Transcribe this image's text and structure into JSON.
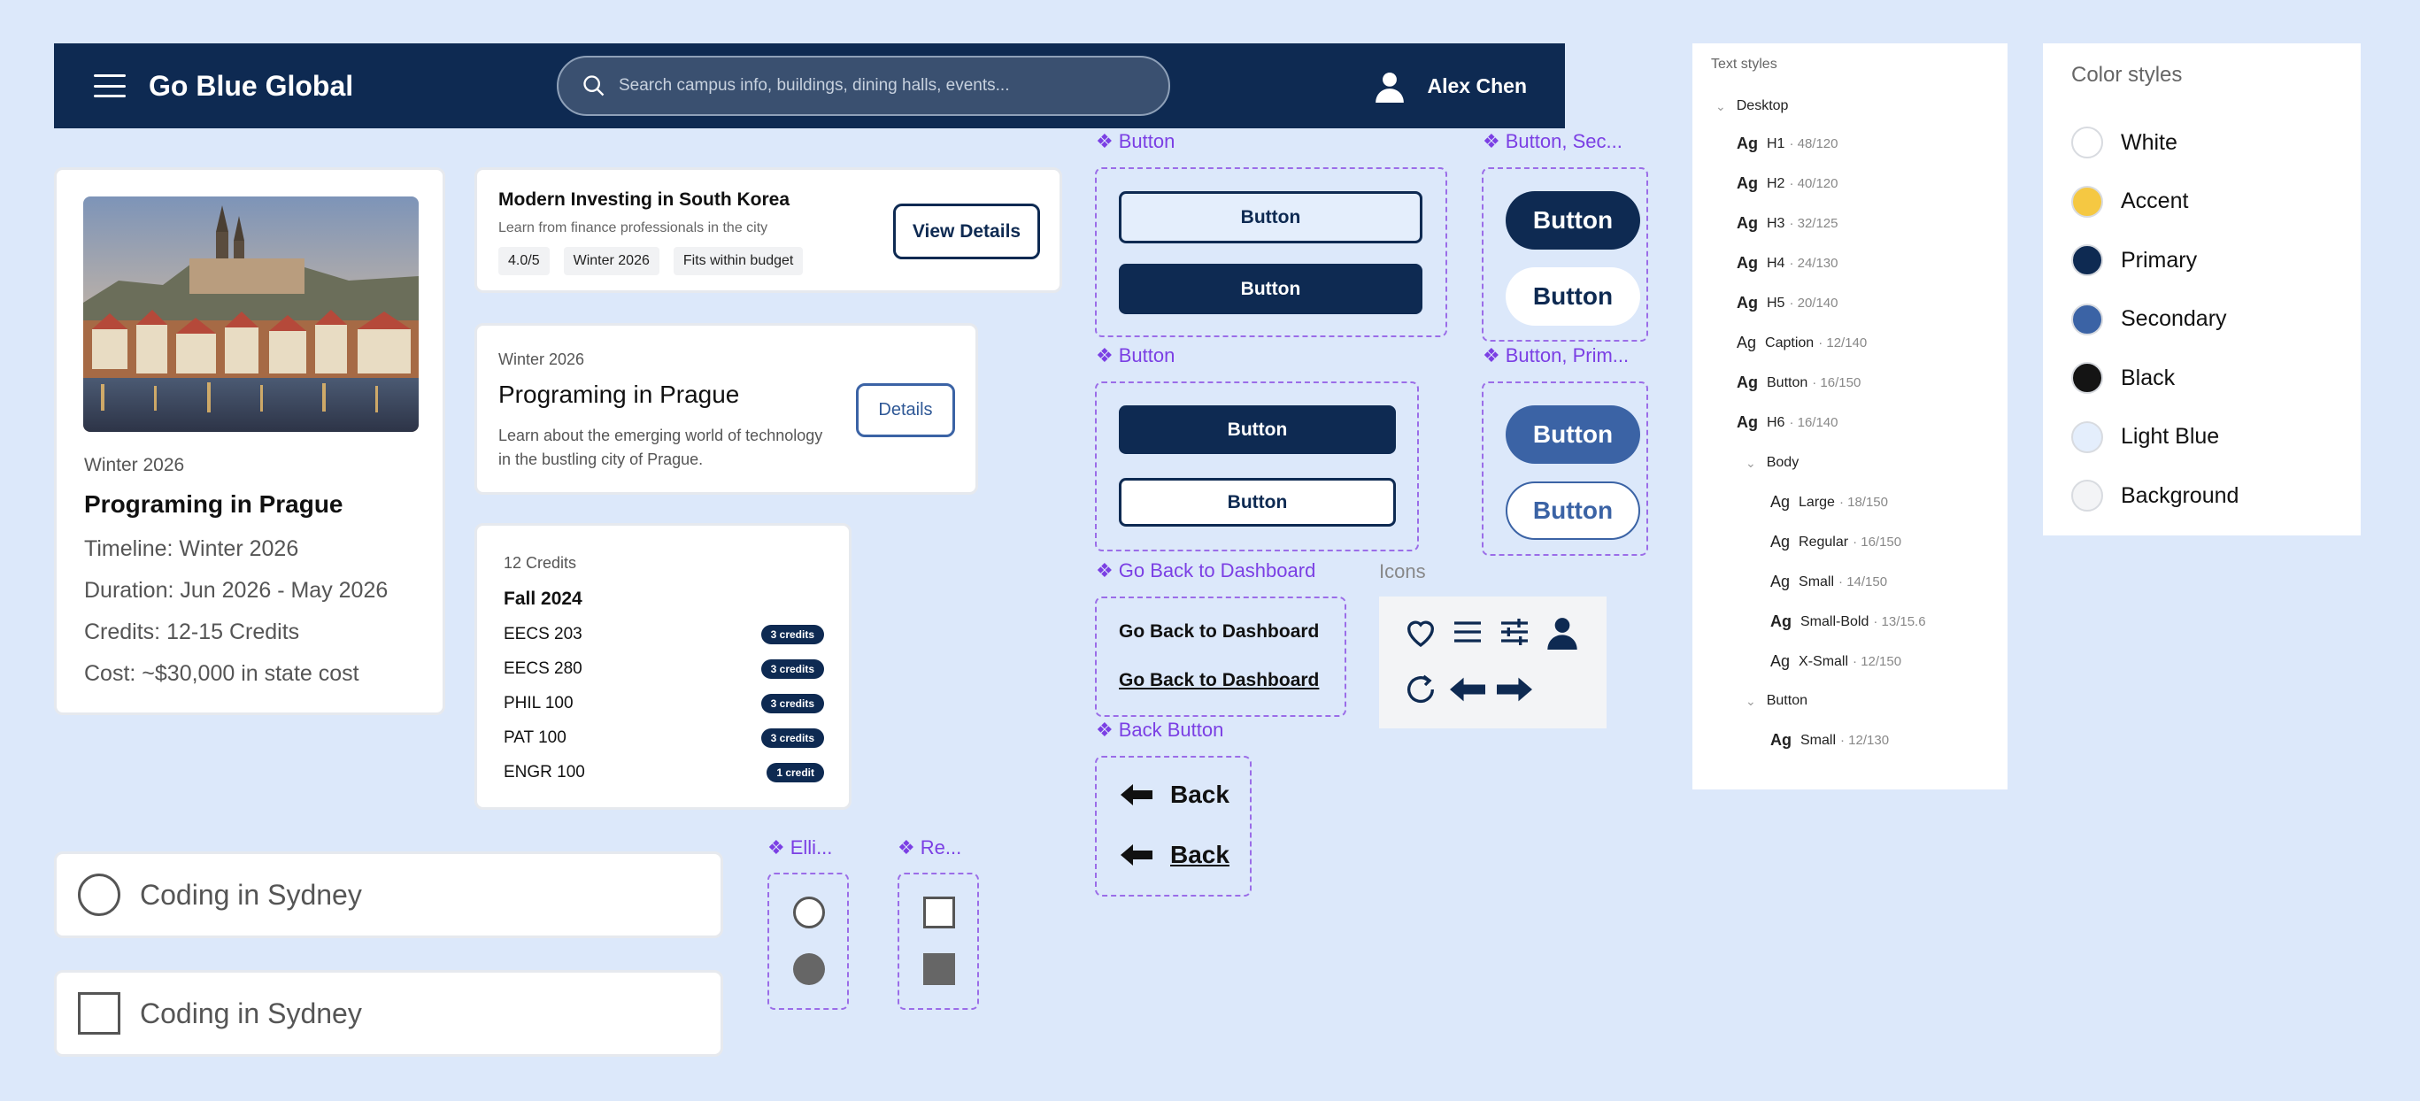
{
  "header": {
    "title": "Go Blue Global",
    "search_placeholder": "Search campus info, buildings, dining halls, events...",
    "user_name": "Alex Chen"
  },
  "main_card": {
    "term": "Winter 2026",
    "title": "Programing in Prague",
    "lines": [
      "Timeline: Winter 2026",
      "Duration: Jun 2026 - May 2026",
      "Credits: 12-15 Credits",
      "Cost: ~$30,000 in state cost"
    ]
  },
  "investing_card": {
    "title": "Modern Investing in South Korea",
    "subtitle": "Learn from finance professionals in the city",
    "tags": [
      "4.0/5",
      "Winter 2026",
      "Fits within budget"
    ],
    "button_label": "View Details"
  },
  "prague_card": {
    "term": "Winter 2026",
    "title": "Programing in Prague",
    "description": "Learn about the emerging world of technology in the bustling city of Prague.",
    "button_label": "Details"
  },
  "credits_card": {
    "credits_label": "12 Credits",
    "semester": "Fall 2024",
    "courses": [
      {
        "name": "EECS 203",
        "credits": "3 credits"
      },
      {
        "name": "EECS 280",
        "credits": "3 credits"
      },
      {
        "name": "PHIL 100",
        "credits": "3 credits"
      },
      {
        "name": "PAT 100",
        "credits": "3 credits"
      },
      {
        "name": "ENGR 100",
        "credits": "1 credit"
      }
    ]
  },
  "choices": [
    {
      "label": "Coding in Sydney",
      "kind": "radio"
    },
    {
      "label": "Coding in Sydney",
      "kind": "checkbox"
    }
  ],
  "components": {
    "ellipse_label": "Elli...",
    "rect_label": "Re...",
    "button_label": "Button",
    "button_secondary_label": "Button, Sec...",
    "button_primary_label": "Button, Prim...",
    "go_back_label": "Go Back to Dashboard",
    "back_button_label": "Back Button",
    "button_text": "Button",
    "go_back_text": "Go Back to Dashboard",
    "back_text": "Back",
    "icons_label": "Icons"
  },
  "text_styles": {
    "header": "Text styles",
    "desktop_group": "Desktop",
    "desktop": [
      {
        "ag": "Ag",
        "name": "H1",
        "meta": "· 48/120",
        "bold": true
      },
      {
        "ag": "Ag",
        "name": "H2",
        "meta": "· 40/120",
        "bold": true
      },
      {
        "ag": "Ag",
        "name": "H3",
        "meta": "· 32/125",
        "bold": true
      },
      {
        "ag": "Ag",
        "name": "H4",
        "meta": "· 24/130",
        "bold": true
      },
      {
        "ag": "Ag",
        "name": "H5",
        "meta": "· 20/140",
        "bold": true
      },
      {
        "ag": "Ag",
        "name": "Caption",
        "meta": "· 12/140",
        "bold": false
      },
      {
        "ag": "Ag",
        "name": "Button",
        "meta": "· 16/150",
        "bold": true
      },
      {
        "ag": "Ag",
        "name": "H6",
        "meta": "· 16/140",
        "bold": true
      }
    ],
    "body_group": "Body",
    "body": [
      {
        "ag": "Ag",
        "name": "Large",
        "meta": "· 18/150",
        "bold": false
      },
      {
        "ag": "Ag",
        "name": "Regular",
        "meta": "· 16/150",
        "bold": false
      },
      {
        "ag": "Ag",
        "name": "Small",
        "meta": "· 14/150",
        "bold": false
      },
      {
        "ag": "Ag",
        "name": "Small-Bold",
        "meta": "· 13/15.6",
        "bold": true
      },
      {
        "ag": "Ag",
        "name": "X-Small",
        "meta": "· 12/150",
        "bold": false
      }
    ],
    "button_group": "Button",
    "button": [
      {
        "ag": "Ag",
        "name": "Small",
        "meta": "· 12/130",
        "bold": true
      }
    ]
  },
  "color_styles": {
    "header": "Color styles",
    "colors": [
      {
        "name": "White",
        "hex": "#ffffff"
      },
      {
        "name": "Accent",
        "hex": "#f5c842"
      },
      {
        "name": "Primary",
        "hex": "#0e2a52"
      },
      {
        "name": "Secondary",
        "hex": "#3b63a5"
      },
      {
        "name": "Black",
        "hex": "#141414"
      },
      {
        "name": "Light Blue",
        "hex": "#e4eefc"
      },
      {
        "name": "Background",
        "hex": "#f3f4f6"
      }
    ]
  },
  "icons": [
    "heart-icon",
    "menu-icon",
    "sliders-icon",
    "user-icon",
    "refresh-icon",
    "arrow-left-icon",
    "arrow-right-icon"
  ]
}
